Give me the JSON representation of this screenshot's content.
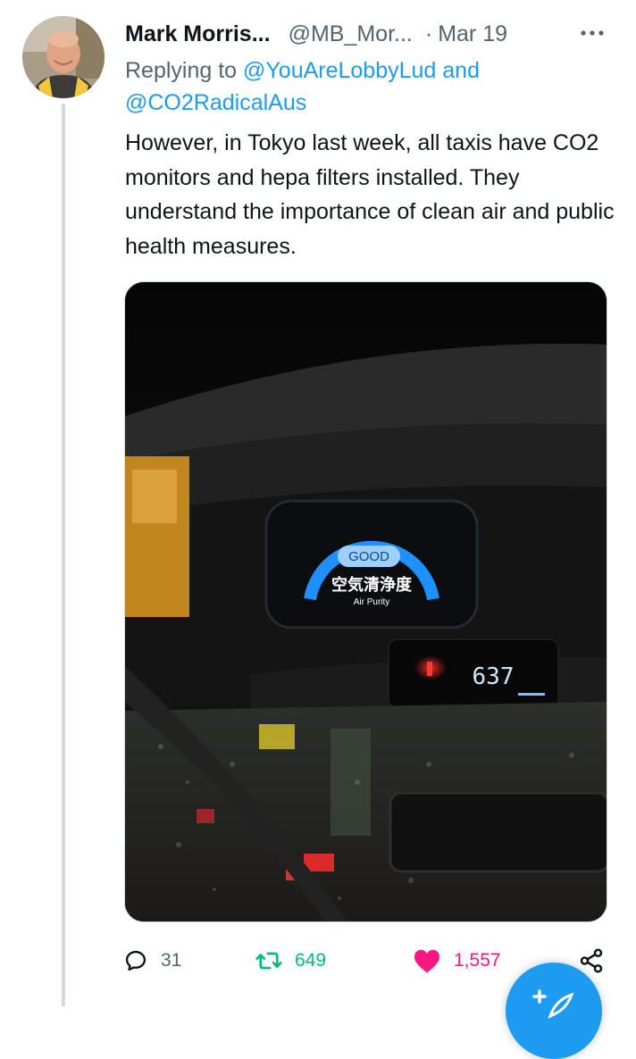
{
  "tweet": {
    "author_name": "Mark Morris...",
    "author_handle": "@MB_Mor...",
    "dot": "·",
    "date": "Mar 19",
    "replying_prefix": "Replying to",
    "reply_mention_1": "@YouAreLobbyLud",
    "reply_joiner": "and",
    "reply_mention_2": "@CO2RadicalAus",
    "text": "However, in Tokyo last week, all taxis have CO2 monitors and hepa filters installed. They understand the importance of clean air and public health measures."
  },
  "media": {
    "monitor_status": "GOOD",
    "monitor_label_ja": "空気清浄度",
    "monitor_label_en": "Air Purity",
    "co2_reading": "637",
    "gauge_color": "#1e90ff"
  },
  "actions": {
    "reply_icon": "reply-icon",
    "reply_count": "31",
    "retweet_icon": "retweet-icon",
    "retweet_count": "649",
    "like_icon": "heart-filled-icon",
    "like_count": "1,557",
    "share_icon": "share-icon"
  },
  "fab": {
    "icon": "compose-feather-icon"
  },
  "colors": {
    "accent": "#1d9bf0",
    "secondary_text": "#536471",
    "retweet": "#00ba7c",
    "like": "#f91880",
    "thread_line": "#cfd9de"
  }
}
